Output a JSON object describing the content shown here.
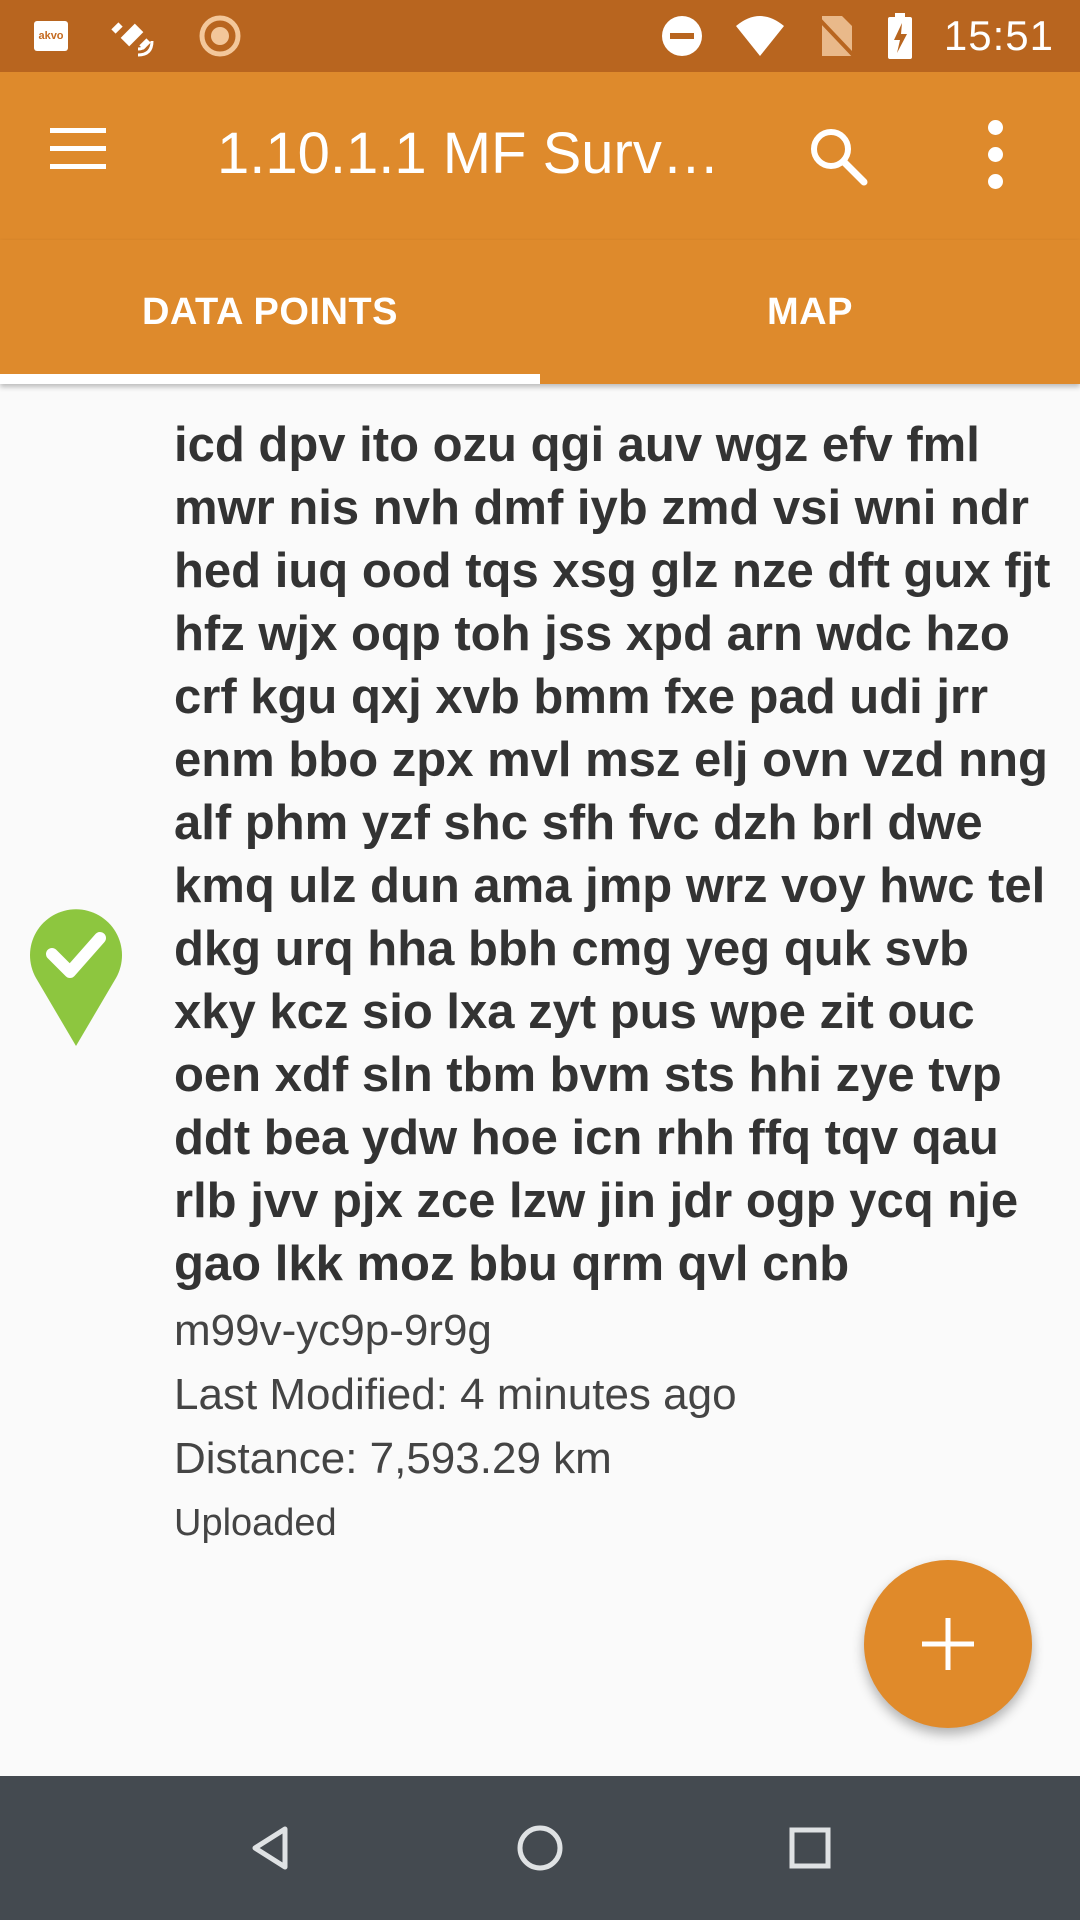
{
  "status_bar": {
    "time": "15:51",
    "left_icons": [
      "akvo-icon",
      "fake-gps-icon",
      "sync-icon"
    ],
    "right_icons": [
      "do-not-disturb-icon",
      "wifi-icon",
      "no-sim-icon",
      "battery-charging-icon"
    ],
    "akvo_label": "akvo"
  },
  "toolbar": {
    "title": "1.10.1.1 MF Surv…",
    "menu_icon": "hamburger-menu-icon",
    "search_icon": "search-icon",
    "overflow_icon": "more-vert-icon"
  },
  "tabs": [
    {
      "label": "DATA POINTS",
      "selected": true
    },
    {
      "label": "MAP",
      "selected": false
    }
  ],
  "data_point": {
    "status_icon": "location-check-marker-icon",
    "status_color": "#8dc63f",
    "title": "icd dpv ito ozu qgi auv wgz efv fml mwr nis nvh dmf iyb zmd vsi wni ndr hed iuq ood tqs xsg glz nze dft gux fjt hfz wjx oqp toh jss xpd arn wdc hzo crf kgu qxj xvb bmm fxe pad udi jrr enm bbo zpx mvl msz elj ovn vzd nng alf phm yzf shc sfh fvc dzh brl dwe kmq ulz dun ama jmp wrz voy hwc tel dkg urq hha bbh cmg yeg quk svb xky kcz sio lxa zyt pus wpe zit ouc oen xdf sln tbm bvm sts hhi zye tvp ddt bea ydw hoe icn rhh ffq tqv qau rlb jvv pjx zce lzw jin jdr ogp ycq nje gao lkk moz bbu qrm qvl cnb",
    "id": "m99v-yc9p-9r9g",
    "last_modified": "Last Modified: 4 minutes ago",
    "distance": "Distance: 7,593.29 km",
    "status": "Uploaded"
  },
  "fab": {
    "icon": "add-icon",
    "color": "#e08a2a"
  },
  "nav_bar": {
    "back_icon": "back-icon",
    "home_icon": "home-icon",
    "recents_icon": "recents-icon"
  },
  "colors": {
    "toolbar": "#de8a2c",
    "status_bar": "#b8651f",
    "nav_bar": "#444a50"
  }
}
